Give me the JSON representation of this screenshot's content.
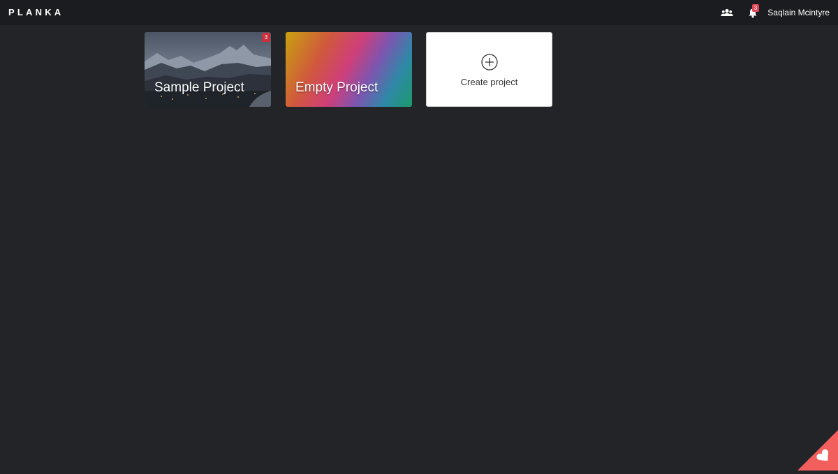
{
  "header": {
    "logo": "PLANKA",
    "notifications_count": "3",
    "user_name": "Saqlain Mcintyre",
    "icons": [
      "users-icon",
      "bell-icon"
    ]
  },
  "projects": [
    {
      "title": "Sample Project",
      "badge": "3",
      "background": "photo"
    },
    {
      "title": "Empty Project",
      "background": "gradient"
    }
  ],
  "create": {
    "label": "Create project",
    "icon": "plus-circle-icon"
  },
  "corner_icon": "heart-icon",
  "colors": {
    "page_bg": "#222428",
    "header_bg": "#1b1c1f",
    "badge": "#e04556",
    "corner": "#f25f5c"
  }
}
